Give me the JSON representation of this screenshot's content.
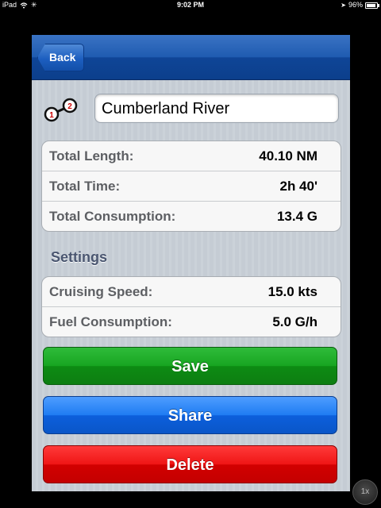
{
  "status": {
    "device": "iPad",
    "time": "9:02 PM",
    "battery": "96%"
  },
  "nav": {
    "back_label": "Back"
  },
  "route": {
    "name": "Cumberland River",
    "icon": "route-waypoints-icon"
  },
  "summary": {
    "rows": [
      {
        "label": "Total Length:",
        "value": "40.10 NM"
      },
      {
        "label": "Total Time:",
        "value": "2h 40'"
      },
      {
        "label": "Total Consumption:",
        "value": "13.4 G"
      }
    ]
  },
  "settings": {
    "header": "Settings",
    "rows": [
      {
        "label": "Cruising Speed:",
        "value": "15.0 kts"
      },
      {
        "label": "Fuel Consumption:",
        "value": "5.0 G/h"
      }
    ]
  },
  "actions": {
    "save_label": "Save",
    "share_label": "Share",
    "delete_label": "Delete",
    "save_color": "#17a521",
    "share_color": "#1f7cf2",
    "delete_color": "#ef1515"
  },
  "zoom": {
    "label": "1x"
  }
}
